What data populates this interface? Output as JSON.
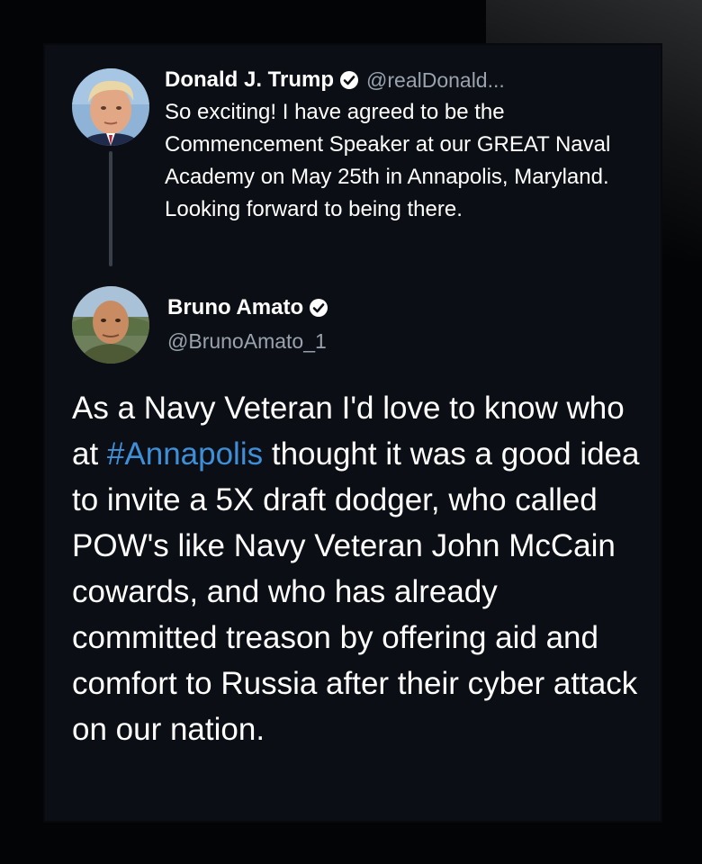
{
  "colors": {
    "background": "#030405",
    "card": "#0b0f15",
    "text": "#ffffff",
    "muted": "#9aa3ad",
    "hashtag": "#3f8fd8",
    "thread_line": "#3a4049"
  },
  "icons": {
    "verified": "verified-badge-icon"
  },
  "tweet1": {
    "name": "Donald J. Trump",
    "handle": "@realDonald...",
    "text": "So exciting! I have agreed to be the Commencement Speaker at our GREAT Naval Academy on May 25th in Annapolis, Maryland. Looking forward to being there."
  },
  "tweet2": {
    "name": "Bruno Amato",
    "handle": "@BrunoAmato_1",
    "text_before": "As a Navy Veteran I'd love to know who at ",
    "hashtag": "#Annapolis",
    "text_after": " thought it was a good idea to invite a 5X draft dodger, who called POW's like Navy Veteran John McCain cowards, and who has already committed treason by offering aid and comfort to Russia after their cyber attack on our nation."
  }
}
